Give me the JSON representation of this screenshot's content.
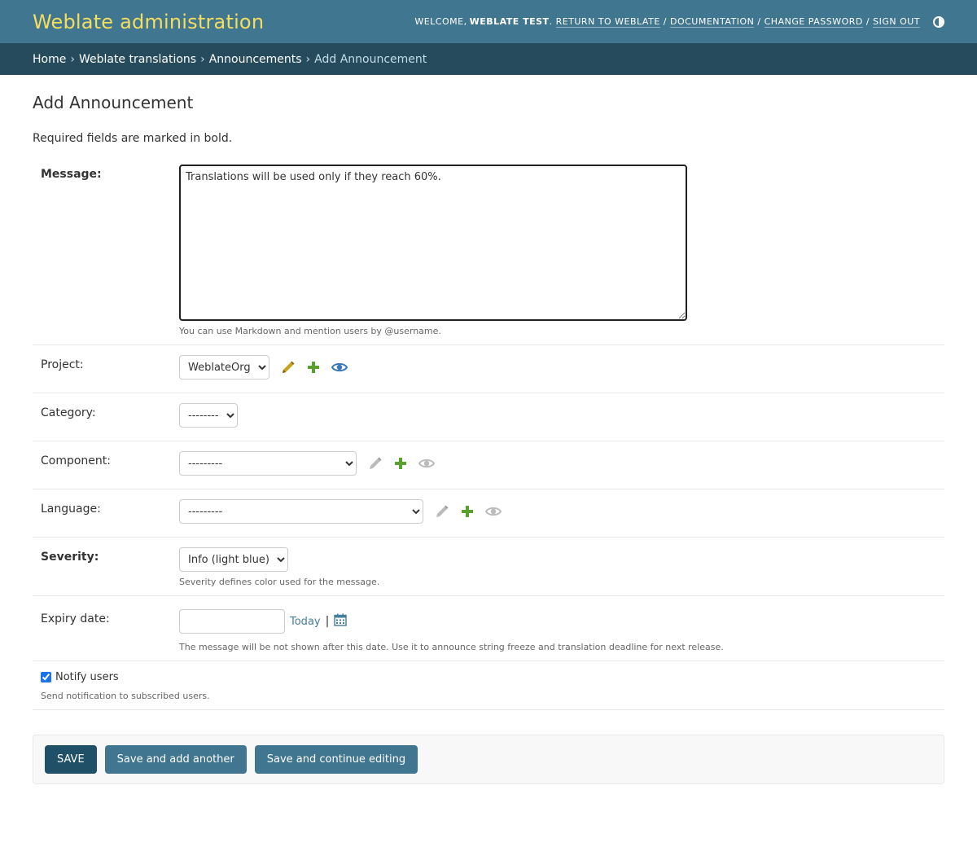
{
  "header": {
    "brand": "Weblate administration",
    "welcome": "Welcome,",
    "username": "Weblate Test",
    "links": {
      "return": "Return to Weblate",
      "docs": "Documentation",
      "change_password": "Change password",
      "sign_out": "Sign out"
    },
    "separator": "/",
    "theme_icon": "theme-toggle-icon"
  },
  "breadcrumbs": {
    "items": [
      "Home",
      "Weblate translations",
      "Announcements"
    ],
    "current": "Add Announcement",
    "separator": "›"
  },
  "page": {
    "title": "Add Announcement",
    "required_note": "Required fields are marked in bold."
  },
  "form": {
    "message": {
      "label": "Message:",
      "value": "Translations will be used only if they reach 60%.",
      "help": "You can use Markdown and mention users by @username."
    },
    "project": {
      "label": "Project:",
      "selected": "WeblateOrg"
    },
    "category": {
      "label": "Category:",
      "selected": "---------"
    },
    "component": {
      "label": "Component:",
      "selected": "---------"
    },
    "language": {
      "label": "Language:",
      "selected": "---------"
    },
    "severity": {
      "label": "Severity:",
      "selected": "Info (light blue)",
      "help": "Severity defines color used for the message."
    },
    "expiry": {
      "label": "Expiry date:",
      "value": "",
      "today": "Today",
      "pipe": "|",
      "help": "The message will be not shown after this date. Use it to announce string freeze and translation deadline for next release."
    },
    "notify": {
      "label": "Notify users",
      "checked": true,
      "help": "Send notification to subscribed users."
    }
  },
  "actions": {
    "save": "Save",
    "save_add": "Save and add another",
    "save_continue": "Save and continue editing"
  },
  "colors": {
    "header_bg": "#417690",
    "breadcrumb_bg": "#264b5d",
    "brand": "#f5dd5d",
    "edit_icon": "#c9a21a",
    "add_icon": "#5aa02c",
    "view_icon": "#3a77b5",
    "disabled_icon": "#bbbbbb"
  }
}
